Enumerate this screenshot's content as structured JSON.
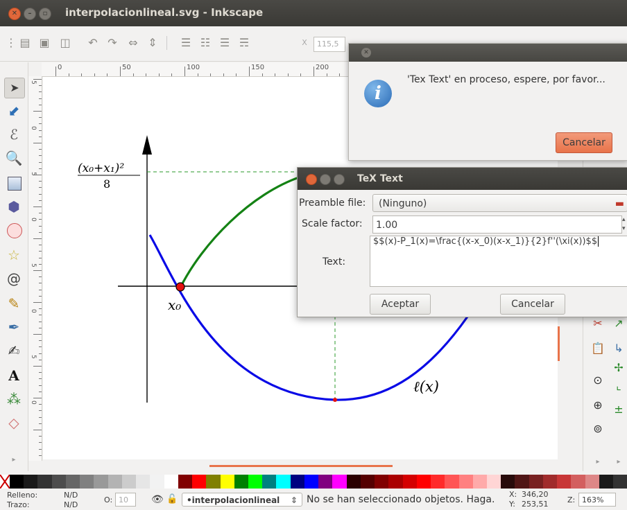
{
  "window": {
    "title": "interpolacionlineal.svg - Inkscape"
  },
  "toolbar": {
    "x_label": "X",
    "x_value": "115,5"
  },
  "ruler": {
    "h_labels": [
      "0",
      "50",
      "100",
      "150",
      "200"
    ],
    "v_labels": [
      "5",
      "0",
      "5",
      "0",
      "5",
      "0",
      "5",
      "0"
    ]
  },
  "figure": {
    "ylabel_num": "(x₀+x₁)²",
    "ylabel_den": "8",
    "x0_label": "x₀",
    "curve_label": "ℓ(x)"
  },
  "busy_dialog": {
    "message": "'Tex Text' en proceso, espere, por favor...",
    "cancel_label": "Cancelar"
  },
  "tex_dialog": {
    "title": "TeX Text",
    "preamble_label": "Preamble file:",
    "preamble_value": "(Ninguno)",
    "scale_label": "Scale factor:",
    "scale_value": "1.00",
    "text_label": "Text:",
    "text_value": "$$(x)-P_1(x)=\\frac{(x-x_0)(x-x_1)}{2}f''(\\xi(x))$$",
    "accept_label": "Aceptar",
    "cancel_label": "Cancelar"
  },
  "status": {
    "fill_label": "Relleno:",
    "fill_value": "N/D",
    "stroke_label": "Trazo:",
    "stroke_value": "N/D",
    "opacity_label": "O:",
    "opacity_value": "10",
    "layer": "•interpolacionlineal",
    "message": "No se han seleccionado objetos. Haga.",
    "x_label": "X:",
    "x_value": "346,20",
    "y_label": "Y:",
    "y_value": "253,51",
    "zoom_label": "Z:",
    "zoom_value": "163%"
  },
  "palette_colors": [
    "#000000",
    "#1a1a1a",
    "#333333",
    "#4d4d4d",
    "#666666",
    "#808080",
    "#999999",
    "#b3b3b3",
    "#cccccc",
    "#e6e6e6",
    "#f2f2f2",
    "#ffffff",
    "#800000",
    "#ff0000",
    "#808000",
    "#ffff00",
    "#008000",
    "#00ff00",
    "#008080",
    "#00ffff",
    "#000080",
    "#0000ff",
    "#800080",
    "#ff00ff",
    "#2b0000",
    "#550000",
    "#800000",
    "#aa0000",
    "#d40000",
    "#ff0000",
    "#ff2a2a",
    "#ff5555",
    "#ff8080",
    "#ffaaaa",
    "#ffd5d5",
    "#280b0b",
    "#501616",
    "#782121",
    "#a02c2c",
    "#c83737",
    "#d35f5f",
    "#de8787",
    "#1a1a1a",
    "#333333"
  ]
}
